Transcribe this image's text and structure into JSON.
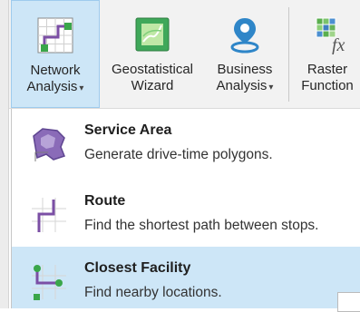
{
  "ribbon": {
    "buttons": [
      {
        "id": "network",
        "line1": "Network",
        "line2": "Analysis",
        "has_dropdown": true,
        "selected": true
      },
      {
        "id": "geo",
        "line1": "Geostatistical",
        "line2": "Wizard",
        "has_dropdown": false
      },
      {
        "id": "business",
        "line1": "Business",
        "line2": "Analysis",
        "has_dropdown": true
      },
      {
        "id": "raster",
        "line1": "Raster",
        "line2": "Function",
        "has_dropdown": false
      }
    ]
  },
  "menu": {
    "items": [
      {
        "title": "Service Area",
        "description": "Generate drive-time polygons.",
        "icon": "service-area-icon"
      },
      {
        "title": "Route",
        "description": "Find the shortest path between stops.",
        "icon": "route-icon"
      },
      {
        "title": "Closest Facility",
        "description": "Find nearby locations.",
        "icon": "closest-facility-icon",
        "highlighted": true
      }
    ]
  },
  "colors": {
    "selected_bg": "#cde6f7",
    "selected_border": "#9ecbed",
    "ribbon_bg": "#f2f2f2"
  }
}
